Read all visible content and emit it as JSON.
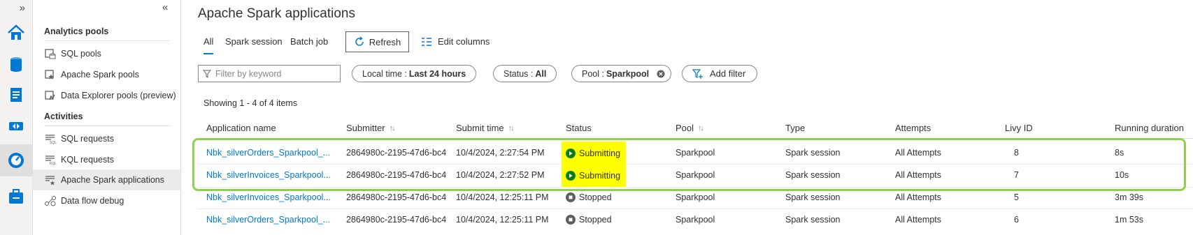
{
  "page": {
    "title": "Apache Spark applications"
  },
  "rail": {
    "expand_label": "»"
  },
  "nav": {
    "collapse_label": "«",
    "sections": [
      {
        "heading": "Analytics pools",
        "items": [
          {
            "label": "SQL pools",
            "icon": "sql-pool-icon"
          },
          {
            "label": "Apache Spark pools",
            "icon": "spark-pool-icon"
          },
          {
            "label": "Data Explorer pools (preview)",
            "icon": "data-explorer-pool-icon"
          }
        ]
      },
      {
        "heading": "Activities",
        "items": [
          {
            "label": "SQL requests",
            "icon": "sql-requests-icon"
          },
          {
            "label": "KQL requests",
            "icon": "kql-requests-icon"
          },
          {
            "label": "Apache Spark applications",
            "icon": "spark-applications-icon",
            "selected": true
          },
          {
            "label": "Data flow debug",
            "icon": "data-flow-debug-icon"
          }
        ]
      }
    ]
  },
  "tabs": [
    "All",
    "Spark session",
    "Batch job"
  ],
  "toolbar": {
    "refresh_label": "Refresh",
    "edit_columns_label": "Edit columns"
  },
  "filters": {
    "keyword_placeholder": "Filter by keyword",
    "local_time_label": "Local time :",
    "local_time_value": "Last 24 hours",
    "status_label": "Status :",
    "status_value": "All",
    "pool_label": "Pool :",
    "pool_value": "Sparkpool",
    "add_filter_label": "Add filter"
  },
  "showing_text": "Showing 1 - 4 of 4 items",
  "table": {
    "columns": [
      "Application name",
      "Submitter",
      "Submit time",
      "Status",
      "Pool",
      "Type",
      "Attempts",
      "Livy ID",
      "Running duration"
    ],
    "rows": [
      {
        "name": "Nbk_silverOrders_Sparkpool_...",
        "submitter": "2864980c-2195-47d6-bc4",
        "submit_time": "10/4/2024, 2:27:54 PM",
        "status": "Submitting",
        "pool": "Sparkpool",
        "type": "Spark session",
        "attempts": "All Attempts",
        "livy_id": "8",
        "duration": "8s"
      },
      {
        "name": "Nbk_silverInvoices_Sparkpool...",
        "submitter": "2864980c-2195-47d6-bc4",
        "submit_time": "10/4/2024, 2:27:52 PM",
        "status": "Submitting",
        "pool": "Sparkpool",
        "type": "Spark session",
        "attempts": "All Attempts",
        "livy_id": "7",
        "duration": "10s"
      },
      {
        "name": "Nbk_silverInvoices_Sparkpool...",
        "submitter": "2864980c-2195-47d6-bc4",
        "submit_time": "10/4/2024, 12:25:11 PM",
        "status": "Stopped",
        "pool": "Sparkpool",
        "type": "Spark session",
        "attempts": "All Attempts",
        "livy_id": "5",
        "duration": "3m 39s"
      },
      {
        "name": "Nbk_silverOrders_Sparkpool_...",
        "submitter": "2864980c-2195-47d6-bc4",
        "submit_time": "10/4/2024, 12:25:11 PM",
        "status": "Stopped",
        "pool": "Sparkpool",
        "type": "Spark session",
        "attempts": "All Attempts",
        "livy_id": "6",
        "duration": "1m 53s"
      }
    ]
  },
  "colors": {
    "accent": "#0078d4",
    "highlight": "#ffff00",
    "highlight_frame": "#8fd14f",
    "submitting": "#107c10",
    "stopped": "#605e5c"
  }
}
